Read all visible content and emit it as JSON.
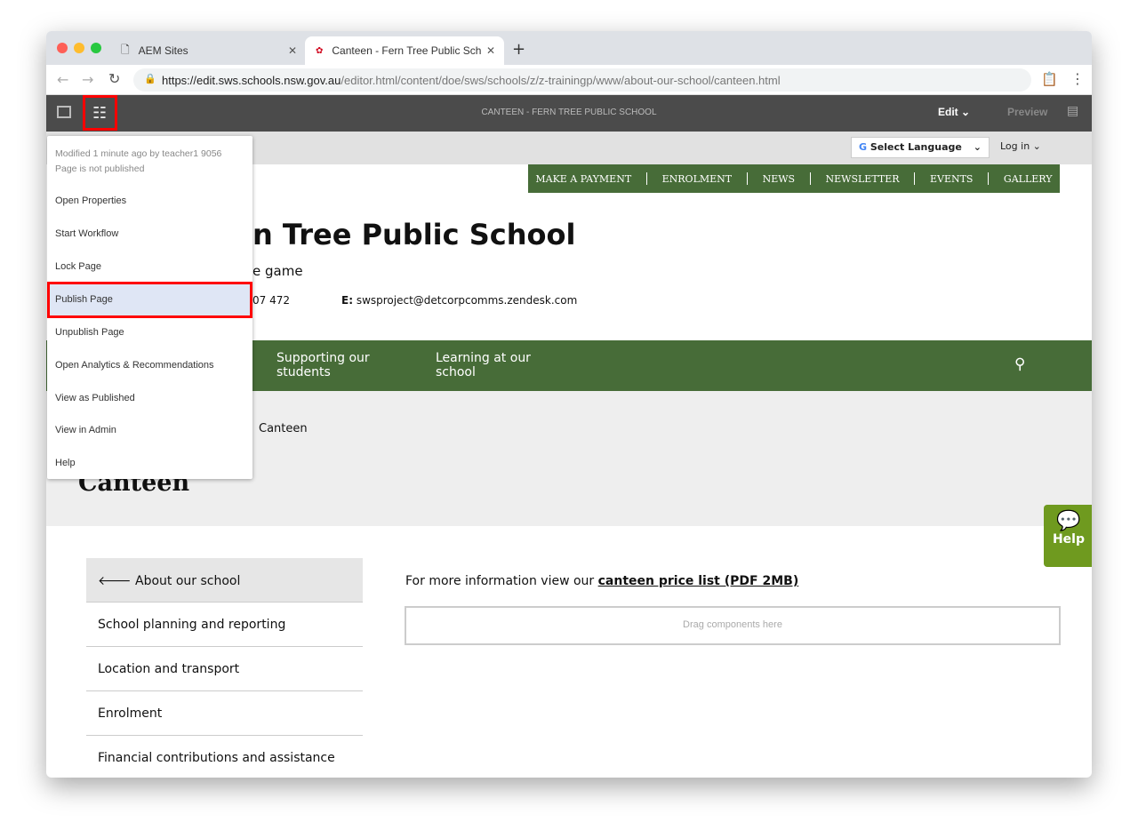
{
  "browser": {
    "tabs": [
      {
        "label": "AEM Sites"
      },
      {
        "label": "Canteen - Fern Tree Public Sch"
      }
    ],
    "url_host": "https://edit.sws.schools.nsw.gov.au",
    "url_path": "/editor.html/content/doe/sws/schools/z/z-trainingp/www/about-our-school/canteen.html"
  },
  "aem": {
    "title": "CANTEEN - FERN TREE PUBLIC SCHOOL",
    "edit": "Edit",
    "preview": "Preview"
  },
  "page_menu": {
    "modified": "Modified 1 minute ago by teacher1 9056",
    "status": "Page is not published",
    "items": [
      "Open Properties",
      "Start Workflow",
      "Lock Page",
      "Publish Page",
      "Unpublish Page",
      "Open Analytics & Recommendations",
      "View as Published",
      "View in Admin",
      "Help"
    ],
    "highlighted": "Publish Page"
  },
  "site": {
    "select_language": "Select Language",
    "login": "Log in",
    "top_nav": [
      "MAKE A PAYMENT",
      "ENROLMENT",
      "NEWS",
      "NEWSLETTER",
      "EVENTS",
      "GALLERY"
    ],
    "school_name_visible": "n Tree Public School",
    "tagline_visible": "e game",
    "phone_visible": "07 472",
    "email_label": "E:",
    "email": "swsproject@detcorpcomms.zendesk.com",
    "main_nav": [
      "Supporting our students",
      "Learning at our school"
    ],
    "breadcrumb_current": "Canteen",
    "page_title": "Canteen",
    "side_nav": {
      "back": "About our school",
      "items": [
        "School planning and reporting",
        "Location and transport",
        "Enrolment",
        "Financial contributions and assistance"
      ]
    },
    "info_text": "For more information view our ",
    "info_link": "canteen price list (PDF 2MB)",
    "drag_placeholder": "Drag components here",
    "help": "Help"
  },
  "colors": {
    "green": "#476c38",
    "help_green": "#6f9a1f",
    "aem_bar": "#4b4b4b",
    "highlight": "#dfe6f5",
    "annotation_red": "#ff0000"
  }
}
